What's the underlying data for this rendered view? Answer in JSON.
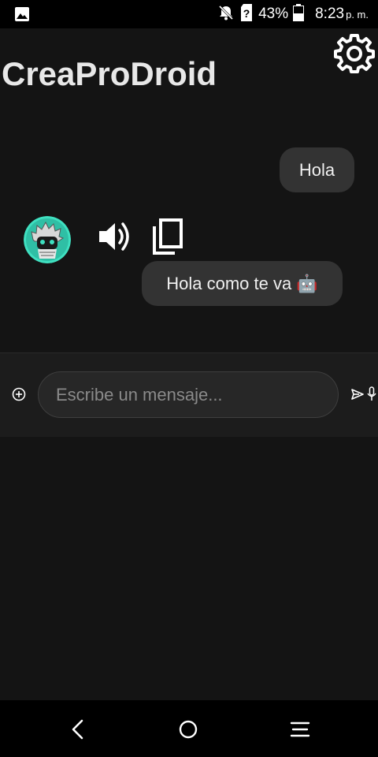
{
  "status_bar": {
    "battery": "43%",
    "time": "8:23",
    "ampm": "p. m.",
    "icons": [
      "image-icon",
      "notifications-off-icon",
      "no-sim-icon",
      "battery-icon"
    ]
  },
  "app": {
    "title": "CreaProDroid",
    "settings_icon": "gear-icon"
  },
  "messages": [
    {
      "role": "user",
      "text": "Hola"
    },
    {
      "role": "bot",
      "text": "Hola como te va 🤖",
      "actions": [
        "speaker-icon",
        "copy-icon"
      ]
    }
  ],
  "composer": {
    "placeholder": "Escribe un mensaje...",
    "value": "",
    "icons": [
      "add-circle-icon",
      "send-icon",
      "mic-icon"
    ]
  },
  "nav_bar": {
    "buttons": [
      "back-icon",
      "home-icon",
      "menu-icon"
    ]
  },
  "colors": {
    "background": "#141414",
    "bubble": "#333333",
    "input_area": "#1c1c1c",
    "accent_avatar": "#3fe0c0"
  }
}
